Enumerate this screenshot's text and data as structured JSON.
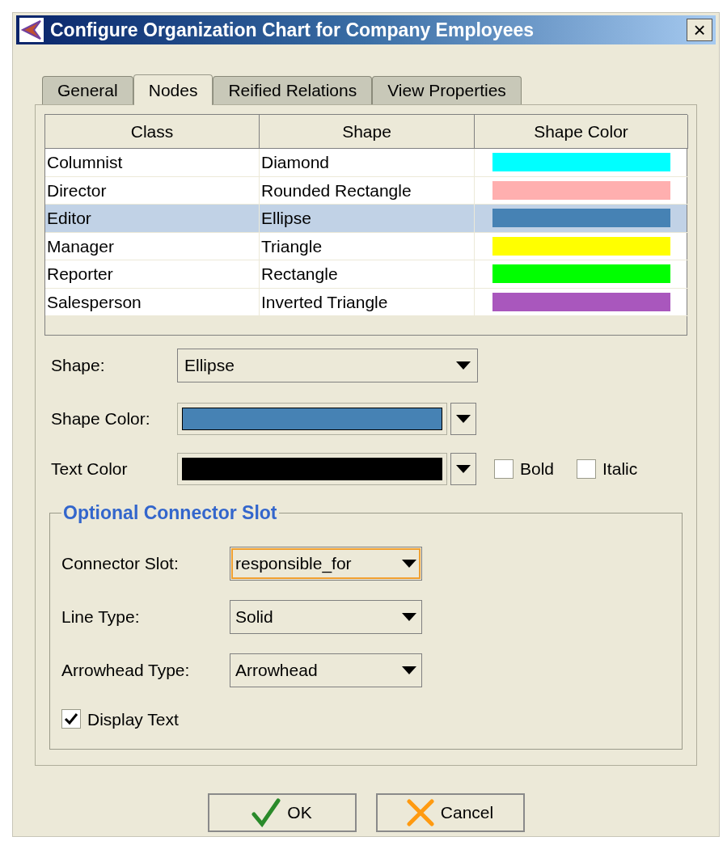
{
  "window": {
    "title": "Configure Organization Chart for Company Employees",
    "close": "×"
  },
  "tabs": [
    {
      "label": "General",
      "selected": false
    },
    {
      "label": "Nodes",
      "selected": true
    },
    {
      "label": "Reified Relations",
      "selected": false
    },
    {
      "label": "View Properties",
      "selected": false
    }
  ],
  "table": {
    "columns": [
      "Class",
      "Shape",
      "Shape Color"
    ],
    "rows": [
      {
        "class": "Columnist",
        "shape": "Diamond",
        "color": "#00ffff",
        "selected": false
      },
      {
        "class": "Director",
        "shape": "Rounded Rectangle",
        "color": "#ffafaf",
        "selected": false
      },
      {
        "class": "Editor",
        "shape": "Ellipse",
        "color": "#4682b4",
        "selected": true
      },
      {
        "class": "Manager",
        "shape": "Triangle",
        "color": "#ffff00",
        "selected": false
      },
      {
        "class": "Reporter",
        "shape": "Rectangle",
        "color": "#00ff00",
        "selected": false
      },
      {
        "class": "Salesperson",
        "shape": "Inverted Triangle",
        "color": "#a957bd",
        "selected": false
      }
    ]
  },
  "shape": {
    "label": "Shape:",
    "value": "Ellipse"
  },
  "shape_color": {
    "label": "Shape Color:",
    "color": "#4682b4"
  },
  "text_color": {
    "label": "Text Color",
    "color": "#000000"
  },
  "style_checks": [
    {
      "label": "Bold",
      "checked": false
    },
    {
      "label": "Italic",
      "checked": false
    }
  ],
  "connector": {
    "title": "Optional Connector Slot",
    "fields": [
      {
        "label": "Connector Slot:",
        "value": "responsible_for",
        "focused": true
      },
      {
        "label": "Line Type:",
        "value": "Solid",
        "focused": false
      },
      {
        "label": "Arrowhead Type:",
        "value": "Arrowhead",
        "focused": false
      }
    ],
    "display_text": {
      "label": "Display Text",
      "checked": true
    }
  },
  "buttons": [
    {
      "kind": "ok",
      "label": "OK"
    },
    {
      "kind": "cancel",
      "label": "Cancel"
    }
  ]
}
